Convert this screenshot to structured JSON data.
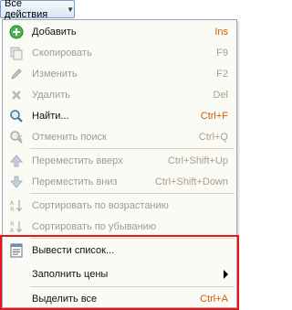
{
  "toolbar": {
    "all_actions_label": "Все действия"
  },
  "menu": {
    "items": [
      {
        "label": "Добавить",
        "shortcut": "Ins",
        "icon": "add-icon",
        "enabled": true
      },
      {
        "label": "Скопировать",
        "shortcut": "F9",
        "icon": "copy-icon",
        "enabled": false
      },
      {
        "label": "Изменить",
        "shortcut": "F2",
        "icon": "pencil-icon",
        "enabled": false
      },
      {
        "label": "Удалить",
        "shortcut": "Del",
        "icon": "delete-icon",
        "enabled": false
      },
      {
        "label": "Найти...",
        "shortcut": "Ctrl+F",
        "icon": "search-icon",
        "enabled": true
      },
      {
        "label": "Отменить поиск",
        "shortcut": "Ctrl+Q",
        "icon": "cancel-search-icon",
        "enabled": false
      },
      {
        "label": "Переместить вверх",
        "shortcut": "Ctrl+Shift+Up",
        "icon": "arrow-up-icon",
        "enabled": false
      },
      {
        "label": "Переместить вниз",
        "shortcut": "Ctrl+Shift+Down",
        "icon": "arrow-down-icon",
        "enabled": false
      },
      {
        "label": "Сортировать по возрастанию",
        "shortcut": "",
        "icon": "sort-ascending-icon",
        "enabled": false
      },
      {
        "label": "Сортировать по убыванию",
        "shortcut": "",
        "icon": "sort-descending-icon",
        "enabled": false
      },
      {
        "label": "Вывести список...",
        "shortcut": "",
        "icon": "output-list-icon",
        "enabled": true
      },
      {
        "label": "Заполнить цены",
        "shortcut": "",
        "icon": "",
        "enabled": true,
        "submenu": true
      },
      {
        "label": "Выделить все",
        "shortcut": "Ctrl+A",
        "icon": "",
        "enabled": true
      }
    ]
  },
  "colors": {
    "shortcut": "#d35a00",
    "disabled_text": "#9a9a9a",
    "highlight_border": "#e8131b",
    "menu_background": "#fbfbf6"
  }
}
